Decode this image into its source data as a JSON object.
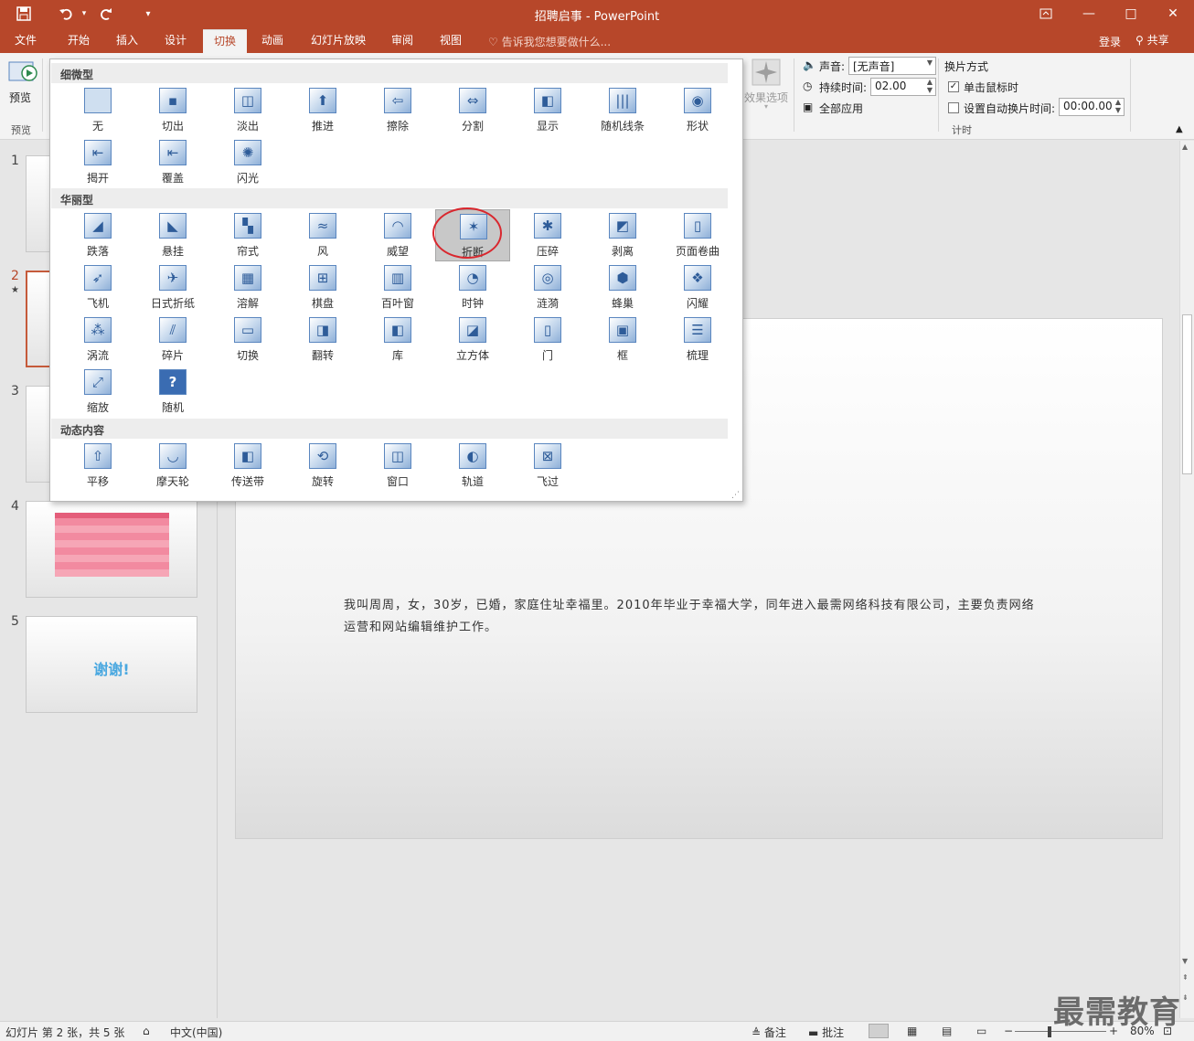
{
  "window": {
    "title": "招聘启事 - PowerPoint",
    "quick_access": {
      "save_icon": "save-icon",
      "undo_icon": "undo-icon",
      "redo_icon": "redo-icon",
      "customize_icon": "customize-icon"
    },
    "controls": {
      "ribbon_display_icon": "ribbon-display-icon",
      "minimize": "—",
      "maximize": "□",
      "close": "✕"
    }
  },
  "tabs": [
    {
      "label": "文件"
    },
    {
      "label": "开始"
    },
    {
      "label": "插入"
    },
    {
      "label": "设计"
    },
    {
      "label": "切换",
      "active": true
    },
    {
      "label": "动画"
    },
    {
      "label": "幻灯片放映"
    },
    {
      "label": "审阅"
    },
    {
      "label": "视图"
    }
  ],
  "tell_me": "告诉我您想要做什么...",
  "account": {
    "login": "登录",
    "share": "共享"
  },
  "ribbon": {
    "preview": {
      "button": "预览",
      "group": "预览"
    },
    "effect_options": "效果选项",
    "sound_label": "声音:",
    "sound_value": "[无声音]",
    "duration_label": "持续时间:",
    "duration_value": "02.00",
    "apply_all": "全部应用",
    "advance_title": "换片方式",
    "on_click": "单击鼠标时",
    "on_click_checked": true,
    "after_label": "设置自动换片时间:",
    "after_checked": false,
    "after_value": "00:00.00",
    "timing_group": "计时"
  },
  "gallery": {
    "sections": [
      {
        "title": "细微型",
        "items": [
          "无",
          "切出",
          "淡出",
          "推进",
          "擦除",
          "分割",
          "显示",
          "随机线条",
          "形状",
          "揭开",
          "覆盖",
          "闪光"
        ]
      },
      {
        "title": "华丽型",
        "items": [
          "跌落",
          "悬挂",
          "帘式",
          "风",
          "威望",
          "折断",
          "压碎",
          "剥离",
          "页面卷曲",
          "飞机",
          "日式折纸",
          "溶解",
          "棋盘",
          "百叶窗",
          "时钟",
          "涟漪",
          "蜂巢",
          "闪耀",
          "涡流",
          "碎片",
          "切换",
          "翻转",
          "库",
          "立方体",
          "门",
          "框",
          "梳理",
          "缩放",
          "随机"
        ]
      },
      {
        "title": "动态内容",
        "items": [
          "平移",
          "摩天轮",
          "传送带",
          "旋转",
          "窗口",
          "轨道",
          "飞过"
        ]
      }
    ],
    "selected": "折断"
  },
  "slides": [
    {
      "number": "1"
    },
    {
      "number": "2",
      "selected": true,
      "star": "★"
    },
    {
      "number": "3"
    },
    {
      "number": "4"
    },
    {
      "number": "5",
      "text": "谢谢!"
    }
  ],
  "current_slide_text": "我叫周周，女，30岁，已婚，家庭住址幸福里。2010年毕业于幸福大学，同年进入最需网络科技有限公司，主要负责网络运营和网站编辑维护工作。",
  "status": {
    "slide_info": "幻灯片 第 2 张，共 5 张",
    "language": "中文(中国)",
    "notes": "备注",
    "comments": "批注",
    "zoom": "80%"
  },
  "watermark": "最需教育",
  "colors": {
    "accent": "#b7472a",
    "selection_circle": "#d9272e",
    "icon_blue": "#3a6cb2"
  }
}
